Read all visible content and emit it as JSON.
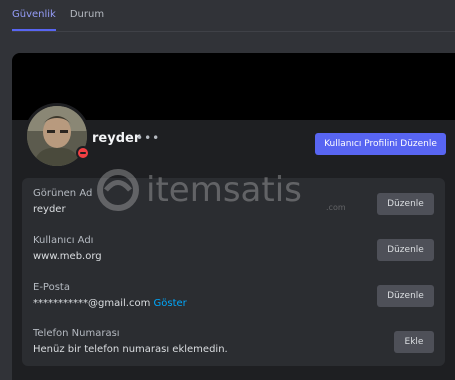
{
  "tabs": [
    {
      "label": "Güvenlik",
      "active": true
    },
    {
      "label": "Durum",
      "active": false
    }
  ],
  "profile": {
    "username": "reyder",
    "more_label": "•••",
    "edit_profile_label": "Kullanıcı Profilini Düzenle",
    "status": "do-not-disturb"
  },
  "fields": {
    "display_name": {
      "label": "Görünen Ad",
      "value": "reyder",
      "button": "Düzenle"
    },
    "username": {
      "label": "Kullanıcı Adı",
      "value": "www.meb.org",
      "button": "Düzenle"
    },
    "email": {
      "label": "E-Posta",
      "value": "***********@gmail.com",
      "reveal": "Göster",
      "button": "Düzenle"
    },
    "phone": {
      "label": "Telefon Numarası",
      "value": "Henüz bir telefon numarası eklemedin.",
      "button": "Ekle"
    }
  },
  "watermark": {
    "text": "itemsatis",
    "domain": ".com"
  },
  "colors": {
    "accent": "#5865f2",
    "dnd": "#f23f43",
    "link": "#00a8fc"
  }
}
